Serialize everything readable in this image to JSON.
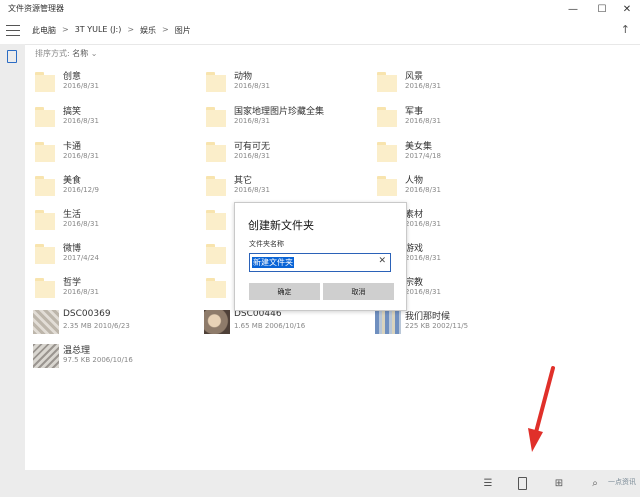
{
  "window": {
    "title": "文件资源管理器",
    "controls": {
      "minimize": "—",
      "maximize": "☐",
      "close": "✕"
    }
  },
  "address": {
    "crumbs": [
      "此电脑",
      "3T YULE (J:)",
      "娱乐",
      "图片"
    ],
    "separator": ">",
    "up_glyph": "↑"
  },
  "sort": {
    "label": "排序方式:",
    "value": "名称"
  },
  "folders": [
    {
      "name": "创意",
      "date": "2016/8/31"
    },
    {
      "name": "动物",
      "date": "2016/8/31"
    },
    {
      "name": "风景",
      "date": "2016/8/31"
    },
    {
      "name": "搞笑",
      "date": "2016/8/31"
    },
    {
      "name": "国家地理图片珍藏全集",
      "date": "2016/8/31"
    },
    {
      "name": "军事",
      "date": "2016/8/31"
    },
    {
      "name": "卡通",
      "date": "2016/8/31"
    },
    {
      "name": "可有可无",
      "date": "2016/8/31"
    },
    {
      "name": "美女集",
      "date": "2017/4/18"
    },
    {
      "name": "美食",
      "date": "2016/12/9"
    },
    {
      "name": "其它",
      "date": "2016/8/31"
    },
    {
      "name": "人物",
      "date": "2016/8/31"
    },
    {
      "name": "生活",
      "date": "2016/8/31"
    },
    {
      "name": "素材",
      "date": "2016/8/31"
    },
    {
      "name": "微博",
      "date": "2017/4/24"
    },
    {
      "name": "游戏",
      "date": "2016/8/31"
    },
    {
      "name": "哲学",
      "date": "2016/8/31"
    },
    {
      "name": "宗教",
      "date": "2016/8/31"
    }
  ],
  "files": [
    {
      "name": "DSC00369",
      "meta": "2.35 MB 2010/6/23"
    },
    {
      "name": "DSC00446",
      "meta": "1.65 MB 2006/10/16"
    },
    {
      "name": "我们那时候",
      "meta": "225 KB 2002/11/5"
    },
    {
      "name": "温总理",
      "meta": "97.5 KB 2006/10/16"
    }
  ],
  "dialog": {
    "title": "创建新文件夹",
    "label": "文件夹名称",
    "input_value": "新建文件夹",
    "clear_glyph": "✕",
    "ok": "确定",
    "cancel": "取消"
  },
  "bottom_icons": [
    "list-view-icon",
    "tablet-icon",
    "grid-view-icon",
    "search-icon"
  ],
  "watermark": "一点资讯",
  "colors": {
    "accent": "#0a64d6",
    "folder": "#fbeeca",
    "arrow": "#e0302a",
    "chrome": "#ececec"
  }
}
